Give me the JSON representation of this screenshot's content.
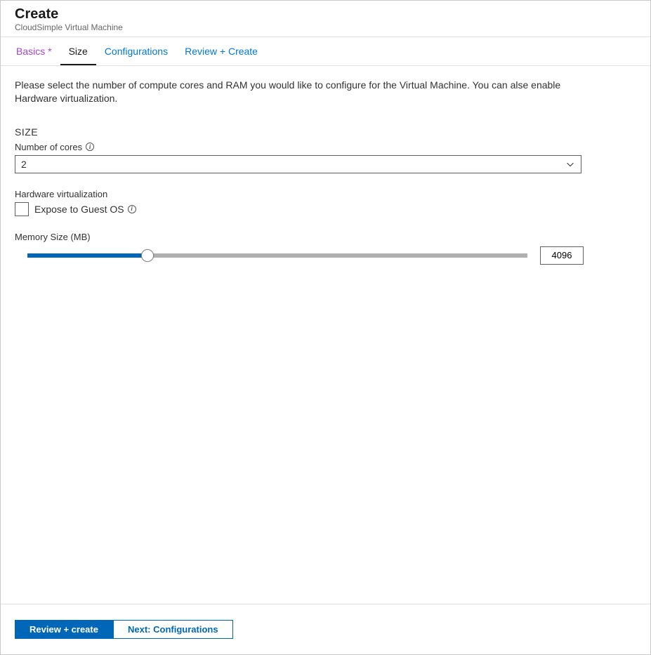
{
  "header": {
    "title": "Create",
    "subtitle": "CloudSimple Virtual Machine"
  },
  "tabs": {
    "basics": "Basics *",
    "size": "Size",
    "configurations": "Configurations",
    "review": "Review + Create"
  },
  "content": {
    "description": "Please select the number of compute cores and RAM you would like to configure for the Virtual Machine. You can alse enable Hardware virtualization.",
    "section_title": "SIZE",
    "cores": {
      "label": "Number of cores",
      "value": "2"
    },
    "hardware_virtualization": {
      "label": "Hardware virtualization",
      "checkbox_label": "Expose to Guest OS",
      "checked": false
    },
    "memory": {
      "label": "Memory Size (MB)",
      "value": "4096",
      "percent": 24
    }
  },
  "footer": {
    "primary": "Review + create",
    "secondary": "Next: Configurations"
  },
  "icons": {
    "info": "i"
  }
}
